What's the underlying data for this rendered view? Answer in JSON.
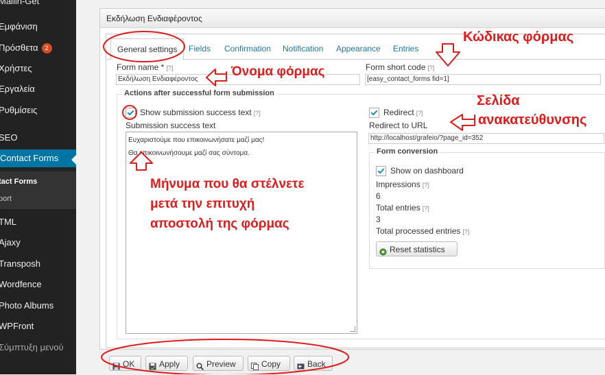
{
  "sidebar": {
    "items": [
      {
        "label": "Mailin-Get"
      },
      {
        "label": "Εμφάνιση"
      },
      {
        "label": "Πρόσθετα",
        "badge": "2"
      },
      {
        "label": "Χρήστες"
      },
      {
        "label": "Εργαλεία"
      },
      {
        "label": "Ρυθμίσεις"
      },
      {
        "label": "SEO"
      },
      {
        "label": "Contact Forms"
      },
      {
        "label": "tact Forms"
      },
      {
        "label": "port"
      },
      {
        "label": "TML"
      },
      {
        "label": "Ajaxy"
      },
      {
        "label": "Transposh"
      },
      {
        "label": "Wordfence"
      },
      {
        "label": "Photo Albums"
      },
      {
        "label": "WPFront"
      },
      {
        "label": "Σύμπτυξη μενού"
      }
    ]
  },
  "panel": {
    "title": "Εκδήλωση Ενδιαφέροντος"
  },
  "tabs": [
    "General settings",
    "Fields",
    "Confirmation",
    "Notification",
    "Appearance",
    "Entries"
  ],
  "form": {
    "name_label": "Form name *",
    "help": "[?]",
    "name_value": "Εκδήλωση Ενδιαφέροντος",
    "short_code_label": "Form short code",
    "short_code_value": "[easy_contact_forms fid=1]",
    "actions_legend": "Actions after successful form submission",
    "show_success_label": "Show submission success text",
    "success_text_label": "Submission success text",
    "success_text_line1": "Ευχαριστούμε που επικοινωνήσατε μαζί μας!",
    "success_text_line2": "Θα επικοινωνήσουμε μαζί σας σύντομα.",
    "redirect_label": "Redirect",
    "redirect_url_label": "Redirect to URL",
    "redirect_url_value": "http://localhost/grafeio/?page_id=352",
    "conversion_legend": "Form conversion",
    "show_dashboard_label": "Show on dashboard",
    "impressions_label": "Impressions",
    "impressions_value": "6",
    "total_entries_label": "Total entries",
    "total_entries_value": "3",
    "total_processed_label": "Total processed entries",
    "reset_button": "Reset statistics"
  },
  "buttons": {
    "ok": "OK",
    "apply": "Apply",
    "preview": "Preview",
    "copy": "Copy",
    "back": "Back"
  },
  "annotations": {
    "form_code": "Κώδικας φόρμας",
    "form_name": "Όνομα φόρμας",
    "redirect_line1": "Σελίδα",
    "redirect_line2": "ανακατεύθυνσης",
    "message_line1": "Μήνυμα που θα στέλνετε",
    "message_line2": "μετά την επιτυχή",
    "message_line3": "αποστολή της φόρμας"
  },
  "colors": {
    "annotation": "#e01b1b",
    "sidebar_active": "#0074a2",
    "link": "#21759b"
  }
}
